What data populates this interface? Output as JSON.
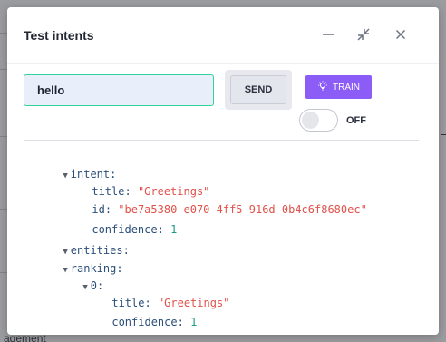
{
  "dialog": {
    "title": "Test intents",
    "minimize_icon": "minimize-icon",
    "collapse_icon": "collapse-icon",
    "close_icon": "close-icon"
  },
  "query": {
    "value": "hello"
  },
  "send_button": {
    "label": "SEND"
  },
  "train_button": {
    "label": "TRAIN",
    "icon": "lightbulb-icon",
    "color": "#8c5cf6"
  },
  "toggle": {
    "state": "OFF"
  },
  "result": {
    "intent_key": "intent",
    "intent": {
      "title_key": "title",
      "title": "\"Greetings\"",
      "id_key": "id",
      "id": "\"be7a5380-e070-4ff5-916d-0b4c6f8680ec\"",
      "confidence_key": "confidence",
      "confidence": "1"
    },
    "entities_key": "entities",
    "ranking_key": "ranking",
    "ranking": [
      {
        "index": "0",
        "title_key": "title",
        "title": "\"Greetings\"",
        "confidence_key": "confidence",
        "confidence": "1"
      }
    ]
  },
  "background": {
    "partial_text_bottom": "agement"
  },
  "colors": {
    "input_border": "#34d39a",
    "string_value": "#e0524a",
    "number_value": "#1f9d84"
  }
}
